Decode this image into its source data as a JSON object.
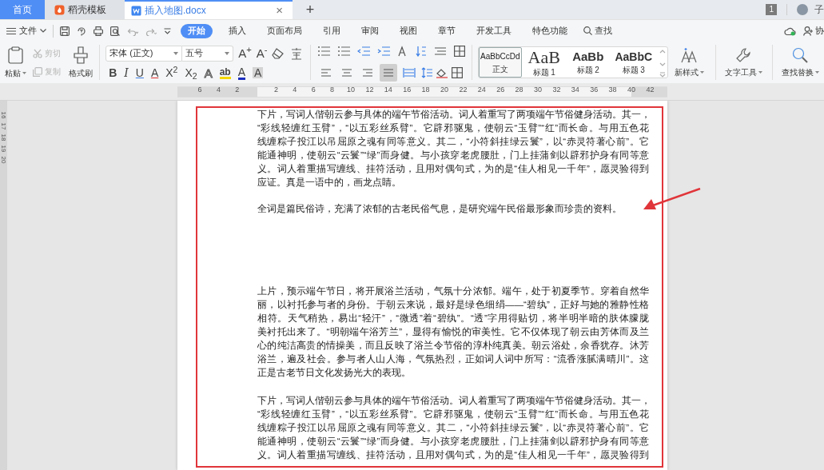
{
  "doc_tabs": [
    {
      "label": "首页",
      "kind": "home",
      "selected": false
    },
    {
      "label": "稻壳模板",
      "kind": "template",
      "selected": false
    },
    {
      "label": "插入地图.docx",
      "kind": "document",
      "selected": true
    }
  ],
  "new_tab": "+",
  "close_tab": "×",
  "notification_count": "1",
  "account_name": "子",
  "file_menu": "文件",
  "menu_tabs": [
    {
      "label": "开始",
      "selected": true
    },
    {
      "label": "插入",
      "selected": false
    },
    {
      "label": "页面布局",
      "selected": false
    },
    {
      "label": "引用",
      "selected": false
    },
    {
      "label": "审阅",
      "selected": false
    },
    {
      "label": "视图",
      "selected": false
    },
    {
      "label": "章节",
      "selected": false
    },
    {
      "label": "开发工具",
      "selected": false
    },
    {
      "label": "特色功能",
      "selected": false
    }
  ],
  "search": "查找",
  "collaborate": "协",
  "clipboard": [
    {
      "label": "粘贴",
      "disabled": false
    },
    {
      "label": "剪切",
      "disabled": true
    },
    {
      "label": "复制",
      "disabled": true
    },
    {
      "label": "格式刷",
      "disabled": false
    }
  ],
  "font_name": "宋体 (正文)",
  "font_size": "五号",
  "font_size_buttons": [
    "A$^{+}$",
    "A$^{-}$"
  ],
  "format_buttons": [
    "B",
    "I",
    "U",
    "A",
    "X$^{2}$",
    "X$_{2}$",
    "A",
    "ab",
    "A",
    "A"
  ],
  "align_buttons": [
    {
      "selected": false
    },
    {
      "selected": false
    },
    {
      "selected": false
    },
    {
      "selected": true
    },
    {
      "selected": false
    }
  ],
  "styles": [
    {
      "preview": "AaBbCcDd",
      "label": "正文",
      "kind": "body",
      "selected": true
    },
    {
      "preview": "AaB",
      "label": "标题 1",
      "kind": "heading1",
      "selected": false
    },
    {
      "preview": "AaBb",
      "label": "标题 2",
      "kind": "heading2",
      "selected": false
    },
    {
      "preview": "AaBbC",
      "label": "标题 3",
      "kind": "heading3",
      "selected": false
    }
  ],
  "new_style": "新样式",
  "text_tools": "文字工具",
  "find_replace": "查找替换",
  "ruler_numbers": [
    "6",
    "4",
    "2",
    "2",
    "4",
    "6",
    "8",
    "10",
    "12",
    "14",
    "16",
    "18",
    "20",
    "22",
    "24",
    "26",
    "28",
    "30",
    "32",
    "34",
    "36",
    "38",
    "40",
    "42"
  ],
  "vertical_ruler_numbers": [
    "16",
    "17",
    "18",
    "19",
    "20"
  ],
  "paragraphs": [
    {
      "lines": [
        "下片，写词人偕朝云参与具体的端午节俗活动。词人着重写了两项端午节俗健身活动。其一，",
        "“彩线轻缠红玉臂”，“以五彩丝系臂”。它辟邪驱鬼，使朝云“玉臂”“红”而长命。与用五色花",
        "线缠粽子投江以吊屈原之魂有同等意义。其二，“小符斜挂绿云鬟”，以“赤灵符著心前”。它",
        "能通神明，使朝云“云鬟”“绿”而身健。与小孩穿老虎腰肚，门上挂蒲剑以辟邪护身有同等意",
        "义。词人着重描写缠线、挂符活动，且用对偶句式，为的是“佳人相见一千年”，愿灵验得到",
        "应证。真是一语中的，画龙点睛。"
      ]
    },
    {
      "lines": [
        "全词是篇民俗诗，充满了浓郁的古老民俗气息，是研究端午民俗最形象而珍贵的资料。"
      ]
    },
    {
      "lines": [
        "上片，预示端午节日，将开展浴兰活动，气氛十分浓郁。端午，处于初夏季节。穿着自然华",
        "丽，以衬托参与者的身份。于朝云来说，最好是绿色细绢——“碧纨”，正好与她的雅静性格",
        "相符。天气稍热，易出“轻汗”，“微透”着“碧纨”。“透”字用得贴切，将半明半暗的肤体朦胧",
        "美衬托出来了。“明朝端午浴芳兰”，显得有愉悦的审美性。它不仅体现了朝云由芳体而及兰",
        "心的纯洁高贵的情操美，而且反映了浴兰令节俗的淳朴纯真美。朝云浴处，余香犹存。沐芳",
        "浴兰，遍及社会。参与者人山人海，气氛热烈，正如词人词中所写：“流香涨腻满晴川”。这",
        "正是古老节日文化发扬光大的表现。"
      ]
    },
    {
      "lines": [
        "下片，写词人偕朝云参与具体的端午节俗活动。词人着重写了两项端午节俗健身活动。其一，",
        "“彩线轻缠红玉臂”，“以五彩丝系臂”。它辟邪驱鬼，使朝云“玉臂”“红”而长命。与用五色花",
        "线缠粽子投江以吊屈原之魂有同等意义。其二，“小符斜挂绿云鬟”，以“赤灵符著心前”。它",
        "能通神明，使朝云“云鬟”“绿”而身健。与小孩穿老虎腰肚，门上挂蒲剑以辟邪护身有同等意",
        "义。词人着重描写缠线、挂符活动，且用对偶句式，为的是“佳人相见一千年”，愿灵验得到"
      ]
    }
  ]
}
